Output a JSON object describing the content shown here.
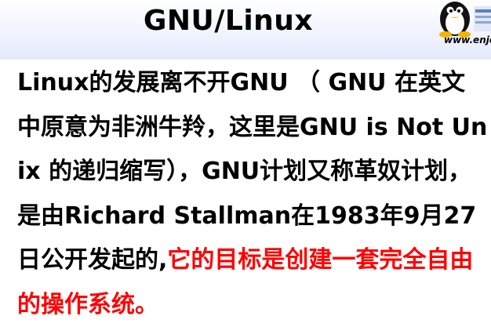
{
  "slide": {
    "title": "GNU/Linux",
    "logo_url": "www.enjo",
    "body": "Linux的发展离不开GNU （ GNU 在英文中原意为非洲牛羚，这里是GNU is Not Unix 的递归缩写），GNU计划又称革奴计划，是由Richard Stallman在1983年9月27日公开发起的,",
    "highlight": "它的目标是创建一套完全自由的操作系统。",
    "colors": {
      "text": "#000000",
      "highlight": "#ff0000"
    },
    "icons": [
      "penguin-icon"
    ]
  }
}
